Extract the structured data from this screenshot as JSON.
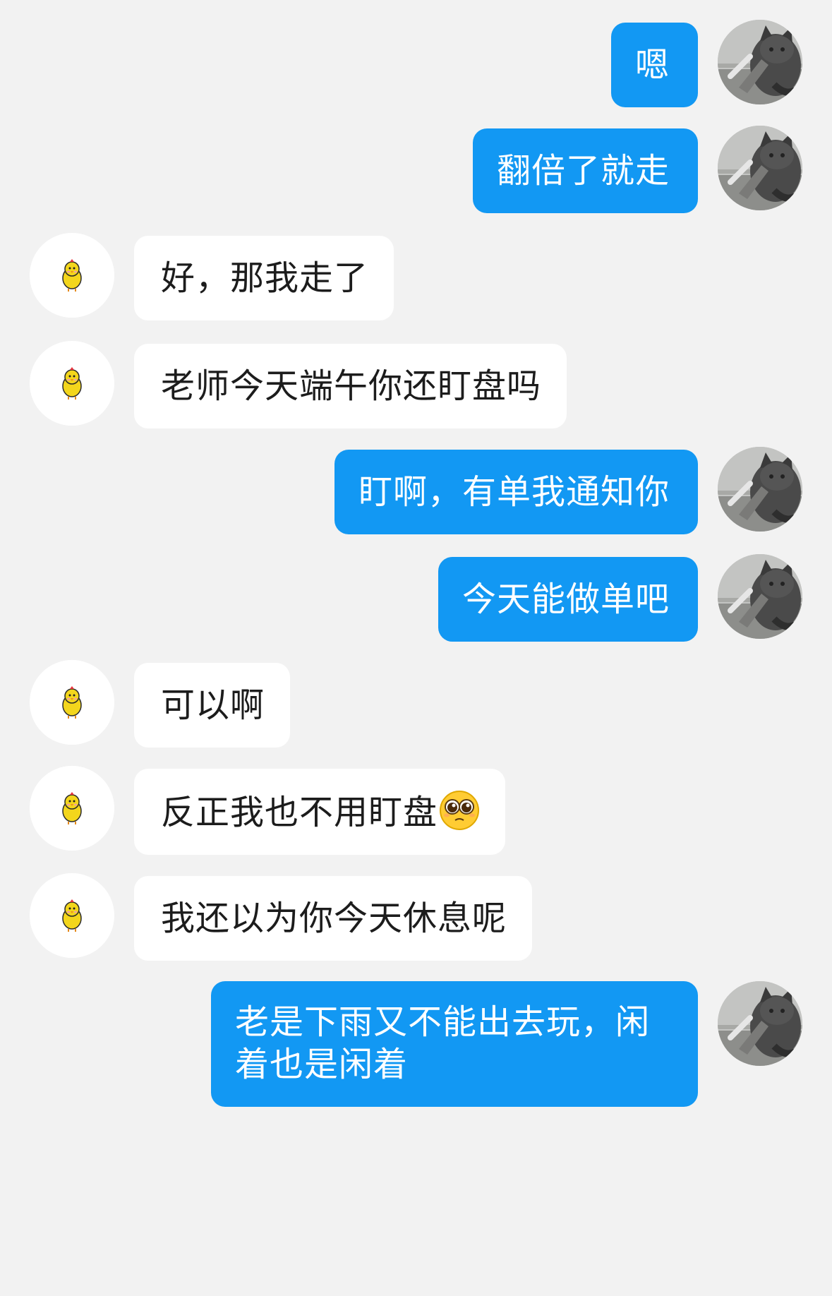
{
  "conversation": {
    "messages": [
      {
        "sender": "me",
        "text": "嗯"
      },
      {
        "sender": "me",
        "text": "翻倍了就走"
      },
      {
        "sender": "them",
        "text": "好，那我走了"
      },
      {
        "sender": "them",
        "text": "老师今天端午你还盯盘吗"
      },
      {
        "sender": "me",
        "text": "盯啊，有单我通知你"
      },
      {
        "sender": "me",
        "text": "今天能做单吧"
      },
      {
        "sender": "them",
        "text": "可以啊"
      },
      {
        "sender": "them",
        "text": "反正我也不用盯盘",
        "emoji": "pleading-face-emoji"
      },
      {
        "sender": "them",
        "text": "我还以为你今天休息呢"
      },
      {
        "sender": "me",
        "text": "老是下雨又不能出去玩，闲着也是闲着"
      }
    ]
  },
  "avatars": {
    "me": "cat-photo-avatar",
    "them": "yellow-chick-avatar"
  },
  "colors": {
    "background": "#f2f2f2",
    "my_bubble": "#1298f3",
    "their_bubble": "#ffffff",
    "my_text": "#ffffff",
    "their_text": "#1c1c1c"
  }
}
